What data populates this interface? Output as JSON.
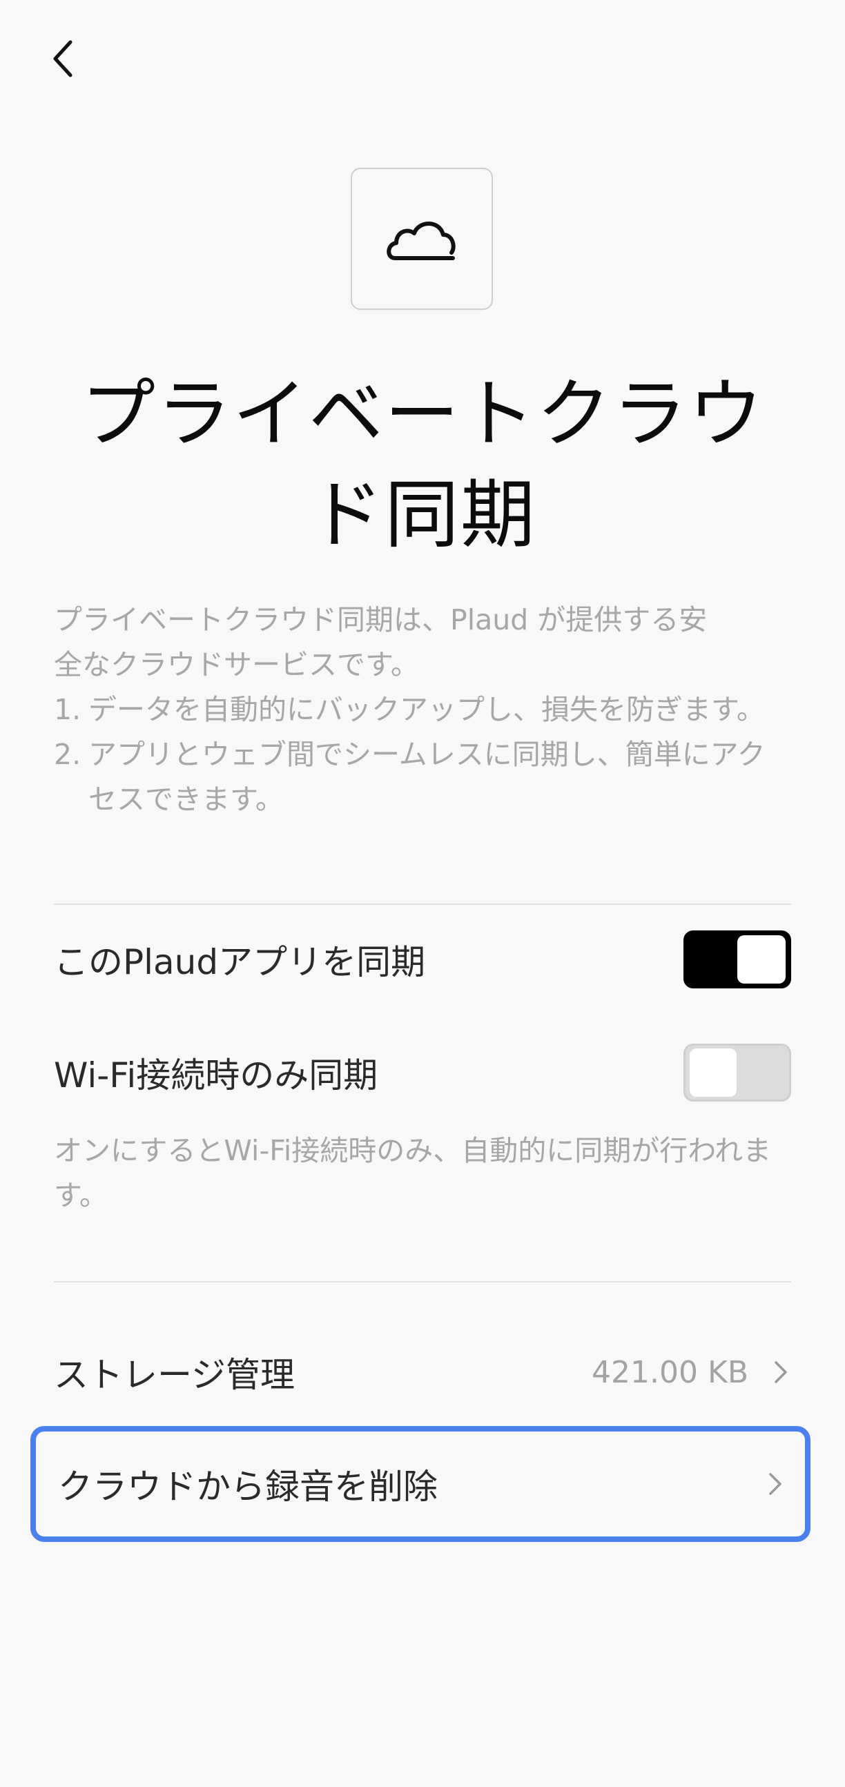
{
  "header": {
    "back_icon": "chevron-left-icon"
  },
  "hero": {
    "icon": "cloud-icon",
    "title_line1": "プライベートクラウ",
    "title_line2": "ド同期"
  },
  "description": {
    "intro_line1": "プライベートクラウド同期は、Plaud が提供する安",
    "intro_line2": "全なクラウドサービスです。",
    "items": [
      {
        "num": "1.",
        "text": "データを自動的にバックアップし、損失を防ぎます。"
      },
      {
        "num": "2.",
        "text": "アプリとウェブ間でシームレスに同期し、簡単にアクセスできます。"
      }
    ]
  },
  "settings": {
    "sync_app_label": "このPlaudアプリを同期",
    "sync_app_on": true,
    "wifi_only_label": "Wi-Fi接続時のみ同期",
    "wifi_only_on": false,
    "wifi_note": "オンにするとWi-Fi接続時のみ、自動的に同期が行われます。"
  },
  "storage": {
    "label": "ストレージ管理",
    "value": "421.00 KB"
  },
  "delete": {
    "label": "クラウドから録音を削除"
  },
  "colors": {
    "background": "#f8f8f8",
    "highlight_border": "#4b80f0",
    "toggle_on": "#000000",
    "toggle_off": "#dcdcdc",
    "muted_text": "#a7a7a7"
  }
}
